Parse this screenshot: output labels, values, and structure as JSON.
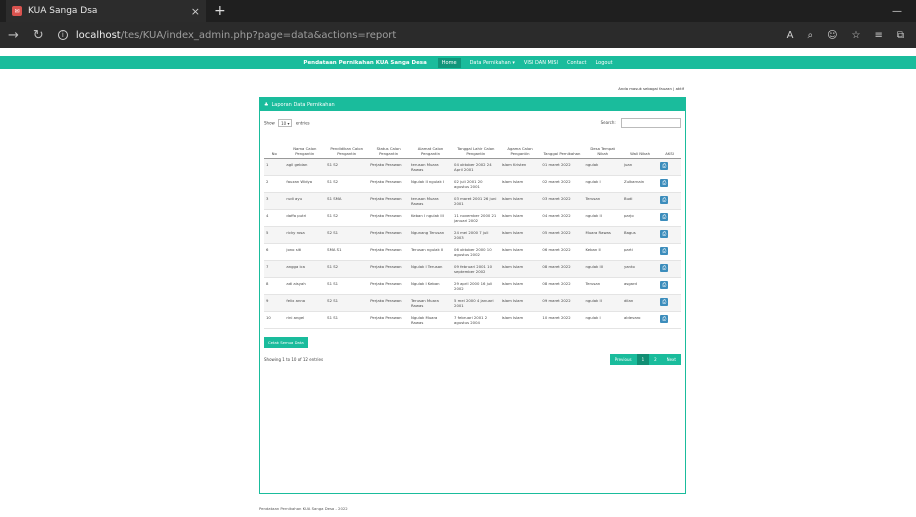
{
  "browser": {
    "tab_title": "KUA Sanga Dsa",
    "url_host": "localhost",
    "url_path": "/tes/KUA/index_admin.php?page=data&actions=report"
  },
  "nav": {
    "brand": "Pendataan Pernikahan KUA Sanga Desa",
    "items": [
      "Home",
      "Data Pernikahan ▾",
      "VISI DAN MISI",
      "Contact",
      "Logout"
    ]
  },
  "greeting": "Anda masuk sebagai fauzan | aktif",
  "panel": {
    "title": "Laporan Data Pernikahan",
    "show_label": "Show",
    "show_value": "10",
    "entries_label": "entries",
    "search_label": "Search:"
  },
  "table": {
    "headers": [
      "No",
      "Nama Calon Pengantin",
      "Pendidikan Calon Pengantin",
      "Status Calon Pengantin",
      "Alamat Calon Pengantin",
      "Tanggal Lahir Calon Pengantin",
      "Agama Calon Pengantin",
      "Tanggal Pernikahan",
      "Desa Tempat Nikah",
      "Wali Nikah",
      "AKSI"
    ],
    "rows": [
      [
        "1",
        "agil gebian",
        "S1 S2",
        "Perjaka Perawan",
        "terusan Muara Rawas",
        "04 oktober 2002 24 April 2001",
        "Islam Kristen",
        "01 maret 2022",
        "ngulak",
        "juan"
      ],
      [
        "2",
        "fauzan Widya",
        "S1 S2",
        "Perjaka Perawan",
        "Ngulak II ngulak I",
        "02 juli 2001 20 agustus 2001",
        "Islam Islam",
        "02 maret 2022",
        "ngulak I",
        "Zulkarnain"
      ],
      [
        "3",
        "rudi ayu",
        "S1 SMA",
        "Perjaka Perawan",
        "terusan Muara Rawas",
        "03 maret 2001 26 juni 2001",
        "Islam Islam",
        "03 maret 2022",
        "Terusan",
        "Budi"
      ],
      [
        "4",
        "daffa putri",
        "S1 S2",
        "Perjaka Perawan",
        "Keban I ngulak III",
        "11 november 2000 21 januari 2002",
        "Islam Islam",
        "04 maret 2022",
        "ngulak II",
        "parjo"
      ],
      [
        "5",
        "ricky rosa",
        "S2 S1",
        "Perjaka Perawan",
        "Ngunang Terusan",
        "24 mei 2000 7 juli 2003",
        "Islam Islam",
        "05 maret 2022",
        "Muara Rawas",
        "Bagus"
      ],
      [
        "6",
        "jono siti",
        "SMA S1",
        "Perjaka Perawan",
        "Terusan ngulak II",
        "06 oktober 2000 10 agustus 2002",
        "Islam Islam",
        "06 maret 2022",
        "Keban II",
        "parti"
      ],
      [
        "7",
        "angga ica",
        "S1 S2",
        "Perjaka Perawan",
        "Ngulak I Terusan",
        "09 februari 2001 10 september 2002",
        "Islam Islam",
        "08 maret 2022",
        "ngulak III",
        "yanto"
      ],
      [
        "8",
        "adi aisyah",
        "S1 S1",
        "Perjaka Perawan",
        "Ngulak I Keban",
        "29 april 2000 16 juli 2002",
        "Islam Islam",
        "08 maret 2022",
        "Terusan",
        "asgard"
      ],
      [
        "9",
        "felix anna",
        "S2 S1",
        "Perjaka Perawan",
        "Terusan Muara Rawas",
        "5 mei 2000 4 januari 2001",
        "Islam Islam",
        "09 maret 2022",
        "ngulak II",
        "dilan"
      ],
      [
        "10",
        "rini angel",
        "S1 S1",
        "Perjaka Perawan",
        "Ngulak Muara Rawas",
        "7 februari 2001 2 agustus 2004",
        "Islam Islam",
        "10 maret 2022",
        "ngulak I",
        "aldevaro"
      ]
    ]
  },
  "print_button": "Cetak Semua Data",
  "showing": "Showing 1 to 10 of 12 entries",
  "pager": [
    "Previous",
    "1",
    "2",
    "Next"
  ],
  "footer": "Pendataan Pernikahan KUA Sanga Desa - 2022",
  "colors": {
    "accent": "#1abc9c",
    "action": "#3c8dbc"
  }
}
